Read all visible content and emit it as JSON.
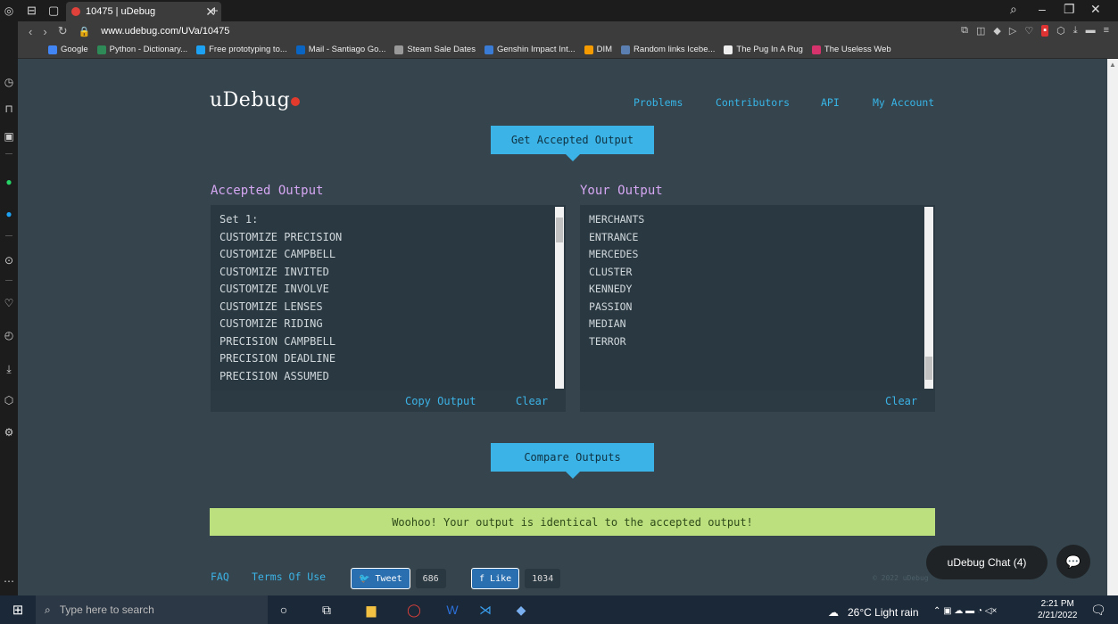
{
  "browser": {
    "tab_title": "10475 | uDebug",
    "url": "www.udebug.com/UVa/10475",
    "bookmarks": [
      {
        "label": "Google",
        "color": "#4285f4"
      },
      {
        "label": "Python - Dictionary...",
        "color": "#2e8b57"
      },
      {
        "label": "Free prototyping to...",
        "color": "#1da1f2"
      },
      {
        "label": "Mail - Santiago Go...",
        "color": "#0a64c2"
      },
      {
        "label": "Steam Sale Dates",
        "color": "#999999"
      },
      {
        "label": "Genshin Impact Int...",
        "color": "#3a7bd5"
      },
      {
        "label": "DIM",
        "color": "#f59b00"
      },
      {
        "label": "Random links Icebe...",
        "color": "#5a7fb0"
      },
      {
        "label": "The Pug In A Rug",
        "color": "#eeeeee"
      },
      {
        "label": "The Useless Web",
        "color": "#d6336c"
      }
    ]
  },
  "site": {
    "logo": "uDebug",
    "nav": [
      "Problems",
      "Contributors",
      "API",
      "My Account"
    ],
    "get_accepted_label": "Get Accepted Output",
    "accepted_title": "Accepted Output",
    "your_title": "Your Output",
    "accepted_lines": [
      "Set 1:",
      "CUSTOMIZE PRECISION",
      "CUSTOMIZE CAMPBELL",
      "CUSTOMIZE INVITED",
      "CUSTOMIZE INVOLVE",
      "CUSTOMIZE LENSES",
      "CUSTOMIZE RIDING",
      "PRECISION CAMPBELL",
      "PRECISION DEADLINE",
      "PRECISION ASSUMED"
    ],
    "your_lines": [
      "MERCHANTS",
      "ENTRANCE",
      "MERCEDES",
      "CLUSTER",
      "KENNEDY",
      "PASSION",
      "MEDIAN",
      "TERROR"
    ],
    "copy_output": "Copy Output",
    "clear": "Clear",
    "compare_label": "Compare Outputs",
    "success_msg": "Woohoo! Your output is identical to the accepted output!",
    "footer": {
      "faq": "FAQ",
      "terms": "Terms Of Use",
      "tweet": "Tweet",
      "tweet_count": "686",
      "like": "Like",
      "like_count": "1034",
      "copyright": "© 2022 uDebug"
    },
    "chat_label": "uDebug Chat (4)"
  },
  "taskbar": {
    "search_placeholder": "Type here to search",
    "weather": "26°C  Light rain",
    "time": "2:21 PM",
    "date": "2/21/2022",
    "notifications": "4"
  }
}
